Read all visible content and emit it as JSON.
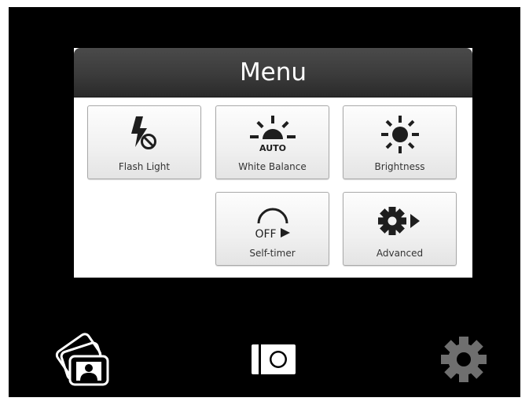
{
  "menu": {
    "title": "Menu",
    "items": [
      {
        "label": "Flash Light",
        "icon": "flash-off-icon"
      },
      {
        "label": "White Balance",
        "icon": "white-balance-auto-icon",
        "icon_text": "AUTO"
      },
      {
        "label": "Brightness",
        "icon": "sun-icon"
      },
      {
        "label": "Self-timer",
        "icon": "timer-off-icon",
        "icon_text": "OFF"
      },
      {
        "label": "Advanced",
        "icon": "gear-arrow-icon"
      }
    ]
  },
  "bottom_bar": {
    "items": [
      {
        "name": "gallery",
        "icon": "photo-gallery-icon"
      },
      {
        "name": "camera",
        "icon": "camera-icon"
      },
      {
        "name": "settings",
        "icon": "gear-icon",
        "state": "inactive"
      }
    ]
  },
  "colors": {
    "screen_background": "#000000",
    "header_background": "#3b3b3b",
    "tile_background": "#f0f0f0",
    "icon_dark": "#1e1e1e",
    "icon_white": "#ffffff",
    "settings_icon_inactive": "#6f6f6f"
  }
}
